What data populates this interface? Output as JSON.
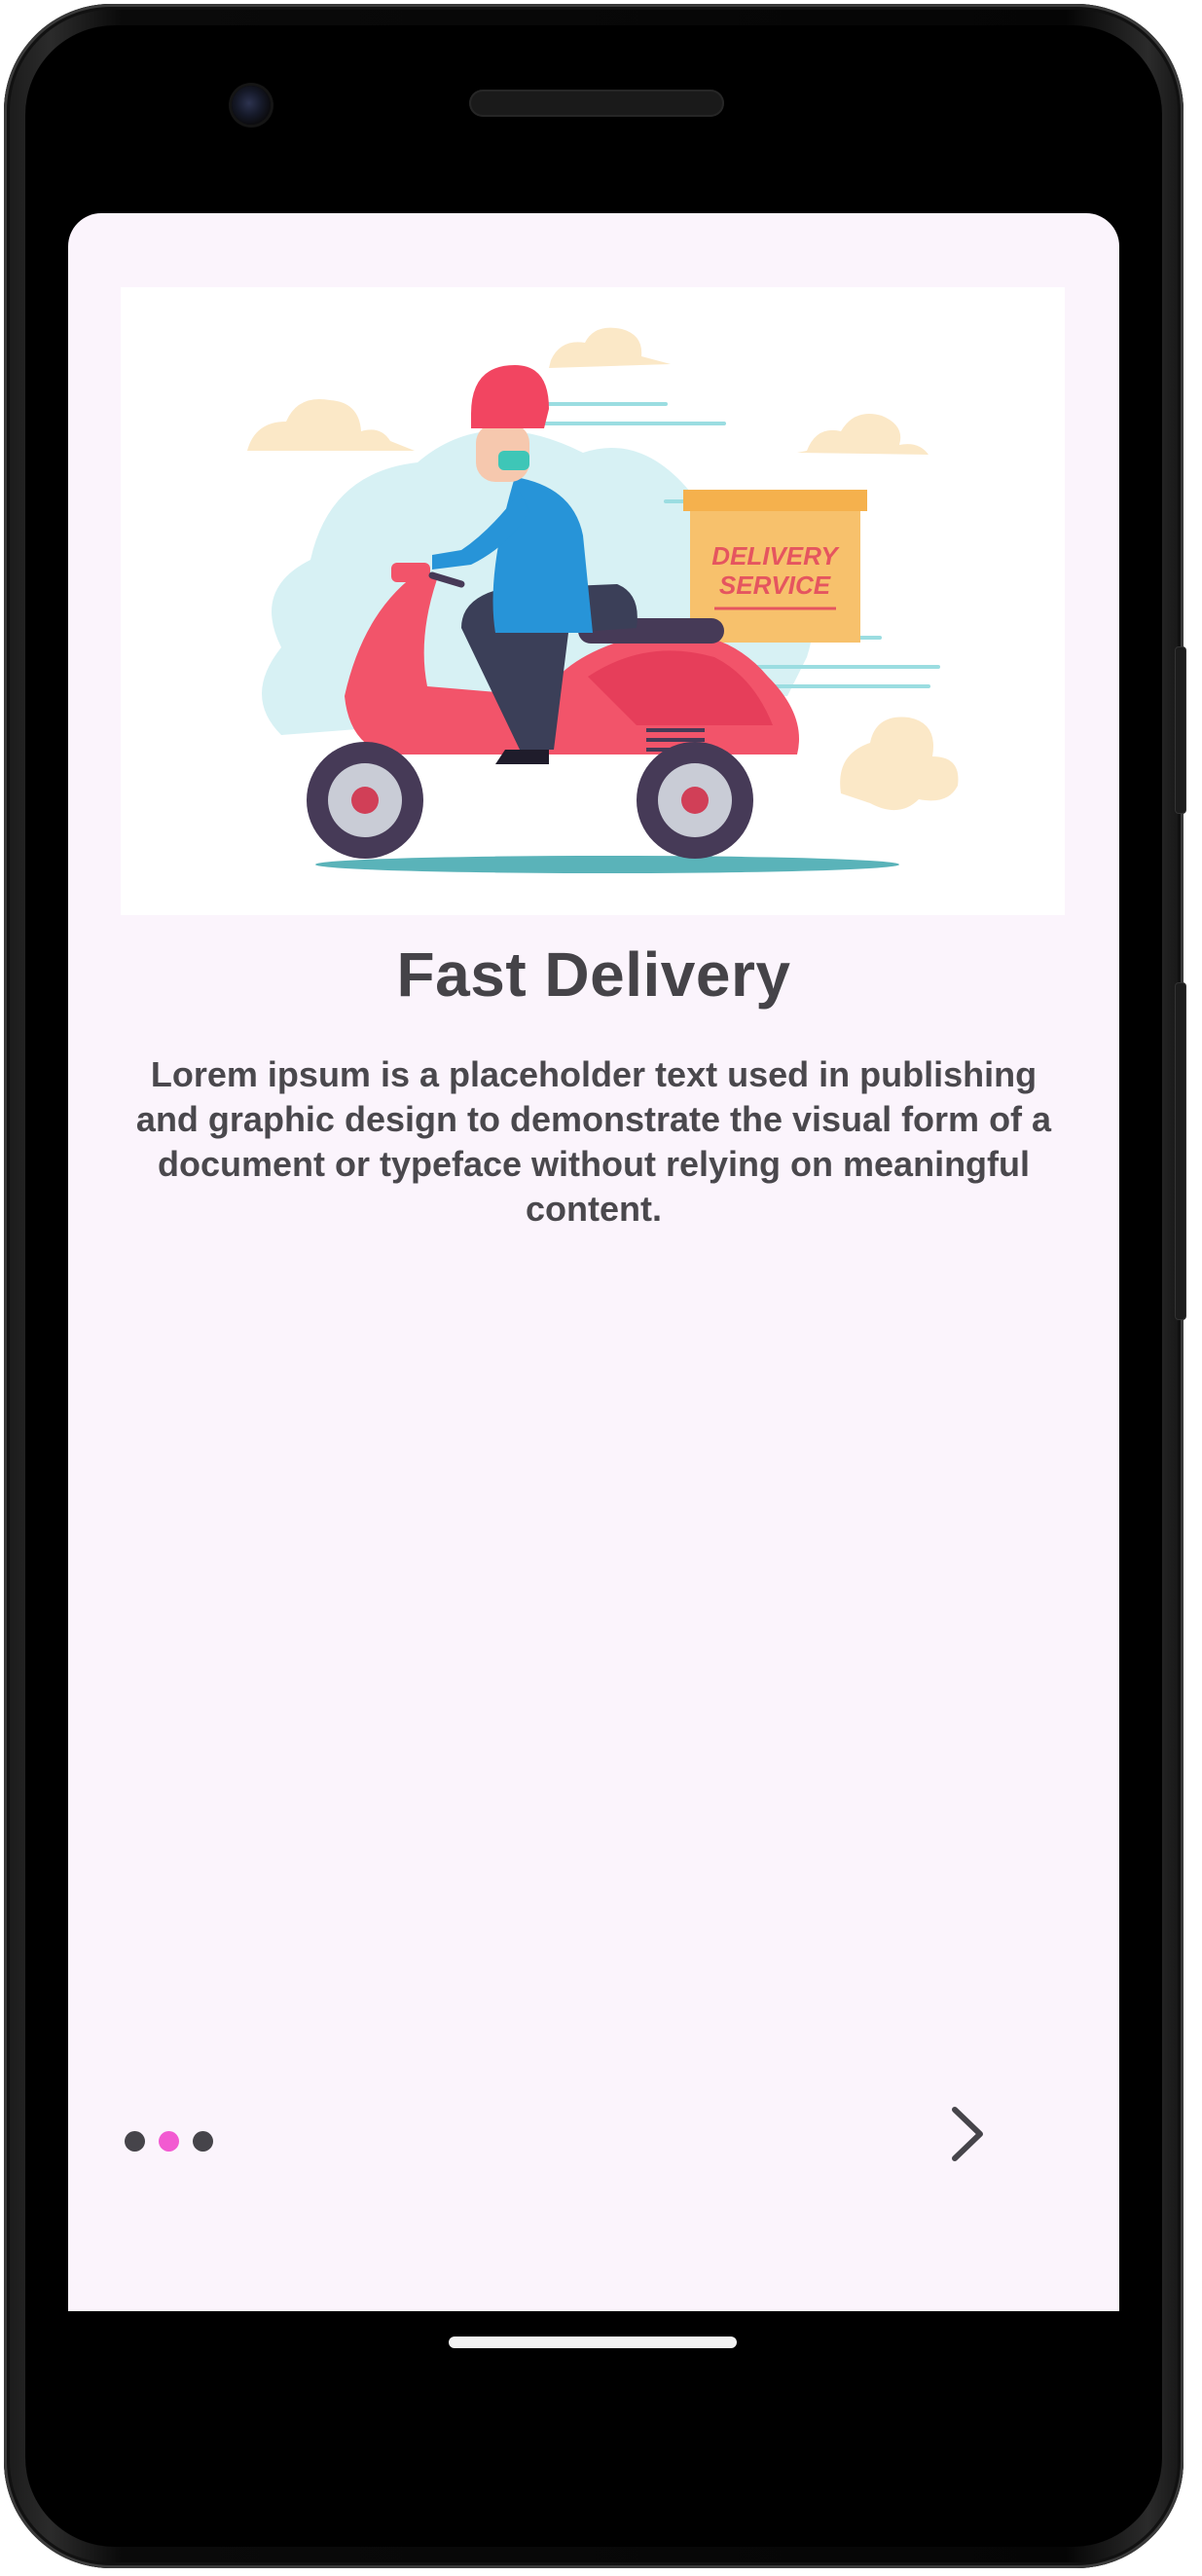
{
  "onboarding": {
    "title": "Fast Delivery",
    "description": "Lorem ipsum is a placeholder text used in publishing and graphic design to demonstrate the visual form of a document or typeface without relying on meaningful content.",
    "illustration": {
      "box_text_line1": "DELIVERY",
      "box_text_line2": "SERVICE"
    },
    "pager": {
      "count": 3,
      "active_index": 1,
      "active_color": "#f25ad1",
      "inactive_color": "#46444a"
    },
    "next_icon": "chevron-right-icon"
  },
  "colors": {
    "screen_background": "#fbf4fc",
    "text": "#454348"
  }
}
